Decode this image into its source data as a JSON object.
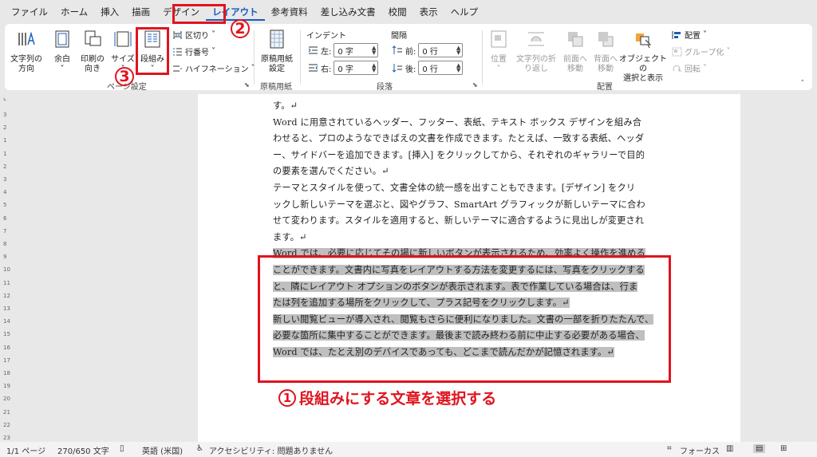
{
  "menu": [
    "ファイル",
    "ホーム",
    "挿入",
    "描画",
    "デザイン",
    "レイアウト",
    "参考資料",
    "差し込み文書",
    "校閲",
    "表示",
    "ヘルプ"
  ],
  "active_menu": "レイアウト",
  "annotations": {
    "n2": "2",
    "n3": "3",
    "caption_num": "1",
    "caption": "段組みにする文章を選択する"
  },
  "ribbon": {
    "page_setup": {
      "text_direction": [
        "文字列の",
        "方向"
      ],
      "margins": "余白",
      "orientation": [
        "印刷の",
        "向き"
      ],
      "size": "サイズ",
      "columns": "段組み",
      "breaks": "区切り",
      "line_numbers": "行番号",
      "hyphenation": "ハイフネーション",
      "label": "ページ設定"
    },
    "manuscript": {
      "button": [
        "原稿用紙",
        "設定"
      ],
      "label": "原稿用紙"
    },
    "paragraph": {
      "indent_header": "インデント",
      "spacing_header": "間隔",
      "left_label": "左:",
      "left_value": "0 字",
      "right_label": "右:",
      "right_value": "0 字",
      "before_label": "前:",
      "before_value": "0 行",
      "after_label": "後:",
      "after_value": "0 行",
      "label": "段落"
    },
    "arrange": {
      "position": "位置",
      "wrap_text": [
        "文字列の折",
        "り返し"
      ],
      "bring_forward": [
        "前面へ",
        "移動"
      ],
      "send_backward": [
        "背面へ",
        "移動"
      ],
      "selection_pane": [
        "オブジェクトの",
        "選択と表示"
      ],
      "align": "配置",
      "group": "グループ化",
      "rotate": "回転",
      "label": "配置"
    }
  },
  "ruler_numbers": [
    "2",
    "4",
    "6",
    "8",
    "10",
    "12",
    "14",
    "16",
    "18",
    "20",
    "22",
    "24",
    "26",
    "28",
    "30",
    "32",
    "34",
    "36",
    "38",
    "40"
  ],
  "vruler_numbers": [
    "3",
    "2",
    "1",
    "1",
    "2",
    "3",
    "4",
    "5",
    "6",
    "7",
    "8",
    "9",
    "10",
    "11",
    "12",
    "13",
    "14",
    "15",
    "16",
    "17",
    "18",
    "19",
    "20",
    "21",
    "22",
    "23"
  ],
  "document": {
    "lines": [
      {
        "text": "す。↵",
        "selected": false
      },
      {
        "text": "Word に用意されているヘッダー、フッター、表紙、テキスト ボックス デザインを組み合",
        "selected": false
      },
      {
        "text": "わせると、プロのようなできばえの文書を作成できます。たとえば、一致する表紙、ヘッダ",
        "selected": false
      },
      {
        "text": "ー、サイドバーを追加できます。[挿入] をクリックしてから、それぞれのギャラリーで目的",
        "selected": false
      },
      {
        "text": "の要素を選んでください。↵",
        "selected": false
      },
      {
        "text": "テーマとスタイルを使って、文書全体の統一感を出すこともできます。[デザイン] をクリ",
        "selected": false
      },
      {
        "text": "ックし新しいテーマを選ぶと、図やグラフ、SmartArt グラフィックが新しいテーマに合わ",
        "selected": false
      },
      {
        "text": "せて変わります。スタイルを適用すると、新しいテーマに適合するように見出しが変更され",
        "selected": false
      },
      {
        "text": "ます。↵",
        "selected": false
      },
      {
        "text": "Word では、必要に応じてその場に新しいボタンが表示されるため、効率よく操作を進める",
        "selected": true
      },
      {
        "text": "ことができます。文書内に写真をレイアウトする方法を変更するには、写真をクリックする",
        "selected": true
      },
      {
        "text": "と、隣にレイアウト オプションのボタンが表示されます。表で作業している場合は、行ま",
        "selected": true
      },
      {
        "text": "たは列を追加する場所をクリックして、プラス記号をクリックします。↵",
        "selected": true
      },
      {
        "text": "新しい閲覧ビューが導入され、閲覧もさらに便利になりました。文書の一部を折りたたんで、",
        "selected": true
      },
      {
        "text": "必要な箇所に集中することができます。最後まで読み終わる前に中止する必要がある場合、",
        "selected": true
      },
      {
        "text": "Word では、たとえ別のデバイスであっても、どこまで読んだかが記憶されます。↵",
        "selected": true
      }
    ]
  },
  "status": {
    "page": "1/1 ページ",
    "words": "270/650 文字",
    "language": "英語 (米国)",
    "accessibility": "アクセシビリティ: 問題ありません",
    "focus": "フォーカス"
  },
  "colors": {
    "annotation_red": "#e0141f",
    "accent_blue": "#185abd",
    "selection_gray": "#bfbfbf"
  }
}
